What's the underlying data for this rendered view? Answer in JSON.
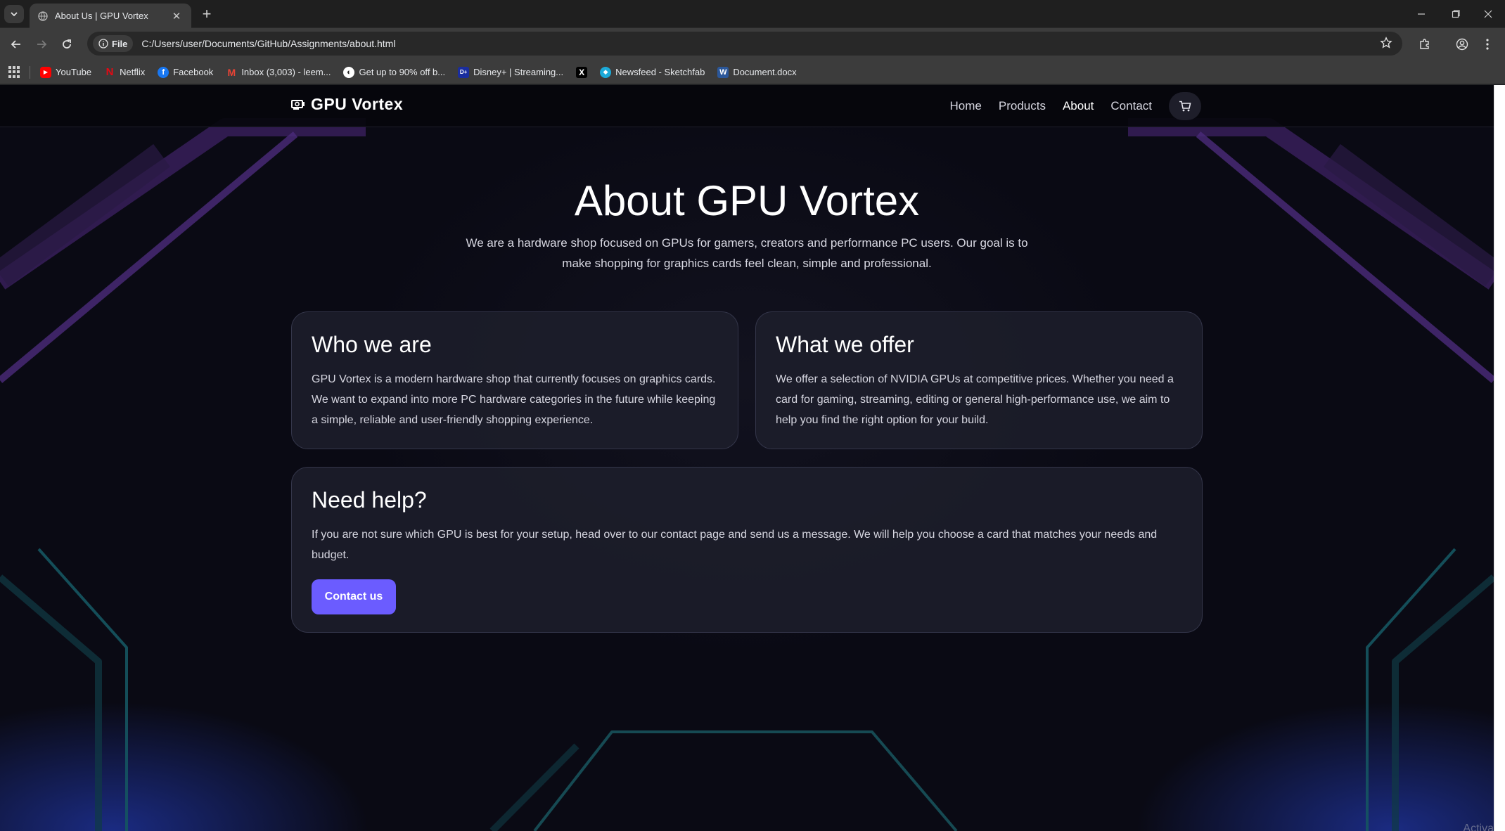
{
  "browser": {
    "tab": {
      "title": "About Us | GPU Vortex"
    },
    "omnibox": {
      "scheme_chip": "File",
      "url": "C:/Users/user/Documents/GitHub/Assignments/about.html"
    },
    "bookmarks": [
      {
        "label": "YouTube",
        "icon": "youtube-icon",
        "color": "#ff0000"
      },
      {
        "label": "Netflix",
        "icon": "netflix-icon",
        "color": "#e50914"
      },
      {
        "label": "Facebook",
        "icon": "facebook-icon",
        "color": "#1877f2"
      },
      {
        "label": "Inbox (3,003) - leem...",
        "icon": "gmail-icon",
        "color": "#ea4335"
      },
      {
        "label": "Get up to 90% off b...",
        "icon": "deal-icon",
        "color": "#ffffff"
      },
      {
        "label": "Disney+ | Streaming...",
        "icon": "disney-icon",
        "color": "#1a2d9e"
      },
      {
        "label": "",
        "icon": "x-icon",
        "color": "#000000"
      },
      {
        "label": "Newsfeed - Sketchfab",
        "icon": "sketchfab-icon",
        "color": "#1caad9"
      },
      {
        "label": "Document.docx",
        "icon": "word-icon",
        "color": "#2b579a"
      }
    ]
  },
  "site": {
    "logo_text": "GPU Vortex",
    "nav": [
      "Home",
      "Products",
      "About",
      "Contact"
    ],
    "active_nav": "About",
    "accent_color": "#6b5cff"
  },
  "hero": {
    "title": "About GPU Vortex",
    "text": "We are a hardware shop focused on GPUs for gamers, creators and performance PC users. Our goal is to make shopping for graphics cards feel clean, simple and professional."
  },
  "cards": {
    "who": {
      "title": "Who we are",
      "text": "GPU Vortex is a modern hardware shop that currently focuses on graphics cards. We want to expand into more PC hardware categories in the future while keeping a simple, reliable and user-friendly shopping experience."
    },
    "offer": {
      "title": "What we offer",
      "text": "We offer a selection of NVIDIA GPUs at competitive prices. Whether you need a card for gaming, streaming, editing or general high-performance use, we aim to help you find the right option for your build."
    },
    "help": {
      "title": "Need help?",
      "text": "If you are not sure which GPU is best for your setup, head over to our contact page and send us a message. We will help you choose a card that matches your needs and budget.",
      "button": "Contact us"
    }
  },
  "watermark": "Activa"
}
